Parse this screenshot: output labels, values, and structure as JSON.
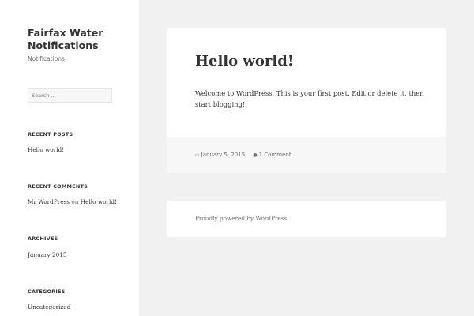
{
  "site": {
    "title": "Fairfax Water Notifications",
    "description": "Notifications"
  },
  "search": {
    "placeholder": "Search …"
  },
  "widgets": {
    "recent_posts": {
      "title": "RECENT POSTS",
      "items": [
        "Hello world!"
      ]
    },
    "recent_comments": {
      "title": "RECENT COMMENTS",
      "author": "Mr WordPress",
      "connector": "on",
      "post": "Hello world!"
    },
    "archives": {
      "title": "ARCHIVES",
      "items": [
        "January 2015"
      ]
    },
    "categories": {
      "title": "CATEGORIES",
      "items": [
        "Uncategorized"
      ]
    }
  },
  "post": {
    "title": "Hello world!",
    "body": "Welcome to WordPress. This is your first post. Edit or delete it, then start blogging!",
    "date": "January 5, 2015",
    "comments": "1 Comment",
    "date_icon": "calendar-icon",
    "comment_icon": "comment-icon"
  },
  "footer": {
    "credit": "Proudly powered by WordPress"
  }
}
